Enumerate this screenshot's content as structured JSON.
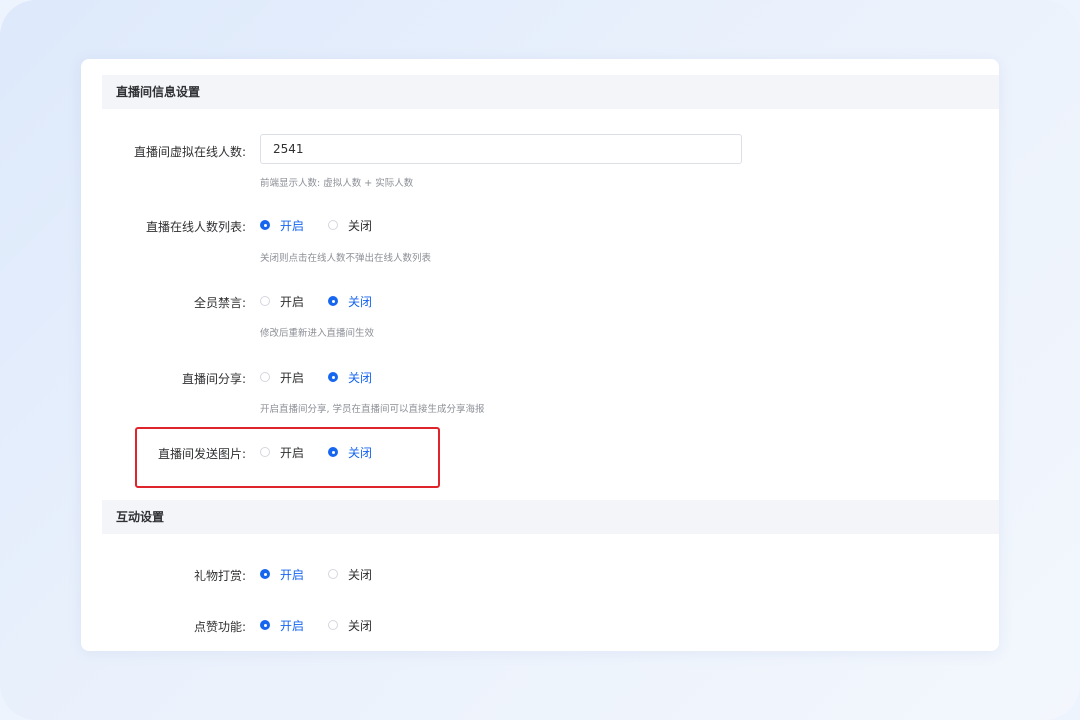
{
  "sections": {
    "live_info": {
      "title": "直播间信息设置"
    },
    "interaction": {
      "title": "互动设置"
    }
  },
  "options": {
    "on": "开启",
    "off": "关闭"
  },
  "rows": {
    "virtual_online": {
      "label": "直播间虚拟在线人数:",
      "value": "2541",
      "hint": "前端显示人数: 虚拟人数 + 实际人数"
    },
    "online_list": {
      "label": "直播在线人数列表:",
      "selected": "on",
      "hint": "关闭则点击在线人数不弹出在线人数列表"
    },
    "mute_all": {
      "label": "全员禁言:",
      "selected": "off",
      "hint": "修改后重新进入直播间生效"
    },
    "share": {
      "label": "直播间分享:",
      "selected": "off",
      "hint": "开启直播间分享, 学员在直播间可以直接生成分享海报"
    },
    "send_image": {
      "label": "直播间发送图片:",
      "selected": "off"
    },
    "gift": {
      "label": "礼物打赏:",
      "selected": "on"
    },
    "like": {
      "label": "点赞功能:",
      "selected": "on"
    }
  },
  "colors": {
    "accent": "#1766f0",
    "highlight_border": "#e0242b",
    "section_bg": "#f3f5f8"
  }
}
